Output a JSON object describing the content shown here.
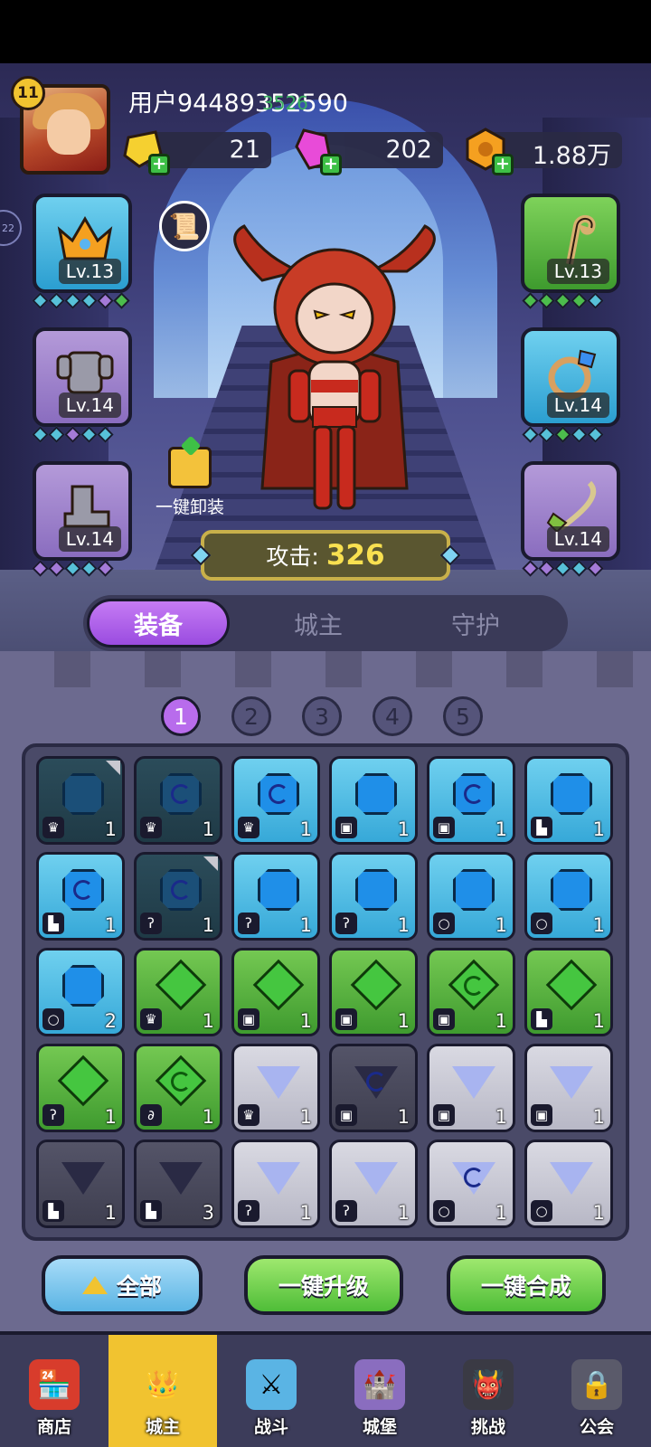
{
  "player": {
    "level": "11",
    "username": "用户94489352590",
    "username_overlay": "3526"
  },
  "resources": [
    {
      "name": "gold-gem",
      "value": "21",
      "color": "#f5d030"
    },
    {
      "name": "pink-gem",
      "value": "202",
      "color": "#e84bd8"
    },
    {
      "name": "coin",
      "value": "1.88万",
      "color": "#f5a020"
    }
  ],
  "equipment": {
    "left": [
      {
        "name": "crown",
        "level": "Lv.13",
        "color": "blue"
      },
      {
        "name": "armor",
        "level": "Lv.14",
        "color": "purple"
      },
      {
        "name": "boot",
        "level": "Lv.14",
        "color": "purple"
      }
    ],
    "right": [
      {
        "name": "staff",
        "level": "Lv.13",
        "color": "green"
      },
      {
        "name": "ring",
        "level": "Lv.14",
        "color": "blue"
      },
      {
        "name": "necklace",
        "level": "Lv.14",
        "color": "purple"
      }
    ]
  },
  "unequip_label": "一键卸装",
  "attack": {
    "label": "攻击:",
    "value": "326"
  },
  "tabs": [
    "装备",
    "城主",
    "守护"
  ],
  "pages": [
    "1",
    "2",
    "3",
    "4",
    "5"
  ],
  "inventory": [
    {
      "tier": "dim",
      "gem": "hex",
      "swirl": false,
      "slot": "crown",
      "count": "1",
      "corner": true
    },
    {
      "tier": "dim",
      "gem": "hex",
      "swirl": true,
      "slot": "crown",
      "count": "1",
      "corner": false
    },
    {
      "tier": "blue",
      "gem": "hex",
      "swirl": true,
      "slot": "crown",
      "count": "1",
      "corner": false
    },
    {
      "tier": "blue",
      "gem": "hex",
      "swirl": false,
      "slot": "armor",
      "count": "1",
      "corner": false
    },
    {
      "tier": "blue",
      "gem": "hex",
      "swirl": true,
      "slot": "armor",
      "count": "1",
      "corner": false
    },
    {
      "tier": "blue",
      "gem": "hex",
      "swirl": false,
      "slot": "boot",
      "count": "1",
      "corner": false
    },
    {
      "tier": "blue",
      "gem": "hex",
      "swirl": true,
      "slot": "boot",
      "count": "1",
      "corner": false
    },
    {
      "tier": "dim",
      "gem": "hex",
      "swirl": true,
      "slot": "staff",
      "count": "1",
      "corner": true
    },
    {
      "tier": "blue",
      "gem": "hex",
      "swirl": false,
      "slot": "staff",
      "count": "1",
      "corner": false
    },
    {
      "tier": "blue",
      "gem": "hex",
      "swirl": false,
      "slot": "staff",
      "count": "1",
      "corner": false
    },
    {
      "tier": "blue",
      "gem": "hex",
      "swirl": false,
      "slot": "ring",
      "count": "1",
      "corner": false
    },
    {
      "tier": "blue",
      "gem": "hex",
      "swirl": false,
      "slot": "ring",
      "count": "1",
      "corner": false
    },
    {
      "tier": "blue",
      "gem": "hex",
      "swirl": false,
      "slot": "ring",
      "count": "2",
      "corner": false
    },
    {
      "tier": "green",
      "gem": "diamond",
      "swirl": false,
      "slot": "crown",
      "count": "1",
      "corner": false
    },
    {
      "tier": "green",
      "gem": "diamond",
      "swirl": false,
      "slot": "armor",
      "count": "1",
      "corner": false
    },
    {
      "tier": "green",
      "gem": "diamond",
      "swirl": false,
      "slot": "armor",
      "count": "1",
      "corner": false
    },
    {
      "tier": "green",
      "gem": "diamond",
      "swirl": true,
      "slot": "armor",
      "count": "1",
      "corner": false
    },
    {
      "tier": "green",
      "gem": "diamond",
      "swirl": false,
      "slot": "boot",
      "count": "1",
      "corner": false
    },
    {
      "tier": "green",
      "gem": "diamond",
      "swirl": false,
      "slot": "staff",
      "count": "1",
      "corner": false
    },
    {
      "tier": "green",
      "gem": "diamond",
      "swirl": true,
      "slot": "necklace",
      "count": "1",
      "corner": false
    },
    {
      "tier": "gray",
      "gem": "tri",
      "swirl": false,
      "slot": "crown",
      "count": "1",
      "corner": false
    },
    {
      "tier": "dark",
      "gem": "tri",
      "swirl": true,
      "slot": "armor",
      "count": "1",
      "corner": false
    },
    {
      "tier": "gray",
      "gem": "tri",
      "swirl": false,
      "slot": "armor",
      "count": "1",
      "corner": false
    },
    {
      "tier": "gray",
      "gem": "tri",
      "swirl": false,
      "slot": "armor",
      "count": "1",
      "corner": false
    },
    {
      "tier": "dark",
      "gem": "tri",
      "swirl": false,
      "slot": "boot",
      "count": "1",
      "corner": false
    },
    {
      "tier": "dark",
      "gem": "tri",
      "swirl": false,
      "slot": "boot",
      "count": "3",
      "corner": false
    },
    {
      "tier": "gray",
      "gem": "tri",
      "swirl": false,
      "slot": "staff",
      "count": "1",
      "corner": false
    },
    {
      "tier": "gray",
      "gem": "tri",
      "swirl": false,
      "slot": "staff",
      "count": "1",
      "corner": false
    },
    {
      "tier": "gray",
      "gem": "tri",
      "swirl": true,
      "slot": "ring",
      "count": "1",
      "corner": false
    },
    {
      "tier": "gray",
      "gem": "tri",
      "swirl": false,
      "slot": "ring",
      "count": "1",
      "corner": false
    }
  ],
  "buttons": {
    "all": "全部",
    "upgrade": "一键升级",
    "merge": "一键合成"
  },
  "nav": [
    {
      "name": "shop",
      "label": "商店",
      "icon": "🏪"
    },
    {
      "name": "lord",
      "label": "城主",
      "icon": "👑"
    },
    {
      "name": "battle",
      "label": "战斗",
      "icon": "⚔"
    },
    {
      "name": "castle",
      "label": "城堡",
      "icon": "🏰"
    },
    {
      "name": "challenge",
      "label": "挑战",
      "icon": "👹"
    },
    {
      "name": "guild",
      "label": "公会",
      "icon": "🔒"
    }
  ]
}
